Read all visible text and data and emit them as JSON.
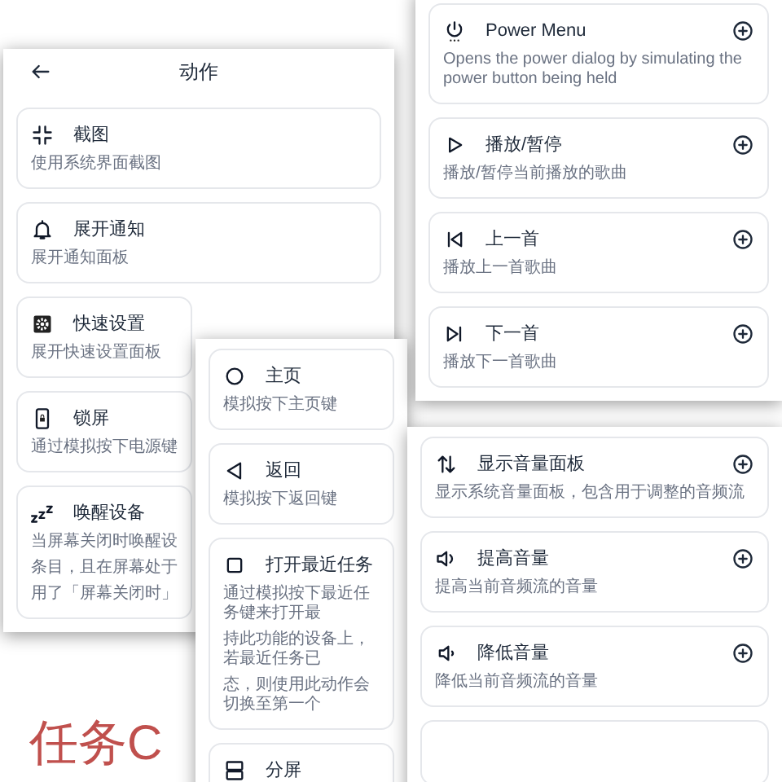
{
  "panels": [
    {
      "header": {
        "title": "动作"
      },
      "cards": [
        {
          "title": "截图",
          "lines": [
            "使用系统界面截图"
          ]
        },
        {
          "title": "展开通知",
          "lines": [
            "展开通知面板"
          ]
        },
        {
          "title": "快速设置",
          "lines": [
            "展开快速设置面板"
          ]
        },
        {
          "title": "锁屏",
          "lines": [
            "通过模拟按下电源键"
          ]
        },
        {
          "title": "唤醒设备",
          "lines": [
            "当屏幕关闭时唤醒设",
            "条目，且在屏幕处于",
            "用了「屏幕关闭时」"
          ]
        }
      ]
    },
    {
      "add_buttons": true,
      "cards": [
        {
          "title": "Power Menu",
          "lines": [
            "Opens the power dialog by simulating the power button being held"
          ]
        },
        {
          "title": "播放/暂停",
          "lines": [
            "播放/暂停当前播放的歌曲"
          ]
        },
        {
          "title": "上一首",
          "lines": [
            "播放上一首歌曲"
          ]
        },
        {
          "title": "下一首",
          "lines": [
            "播放下一首歌曲"
          ]
        }
      ]
    },
    {
      "cards": [
        {
          "title": "主页",
          "lines": [
            "模拟按下主页键"
          ]
        },
        {
          "title": "返回",
          "lines": [
            "模拟按下返回键"
          ]
        },
        {
          "title": "打开最近任务",
          "lines": [
            "通过模拟按下最近任务键来打开最",
            "持此功能的设备上，若最近任务已",
            "态，则使用此动作会切换至第一个"
          ]
        },
        {
          "title": "分屏"
        }
      ]
    },
    {
      "add_buttons": true,
      "cards": [
        {
          "title": "显示音量面板",
          "lines": [
            "显示系统音量面板，包含用于调整的音频流"
          ]
        },
        {
          "title": "提高音量",
          "lines": [
            "提高当前音频流的音量"
          ]
        },
        {
          "title": "降低音量",
          "lines": [
            "降低当前音频流的音量"
          ]
        }
      ]
    }
  ],
  "caption": "任务C"
}
